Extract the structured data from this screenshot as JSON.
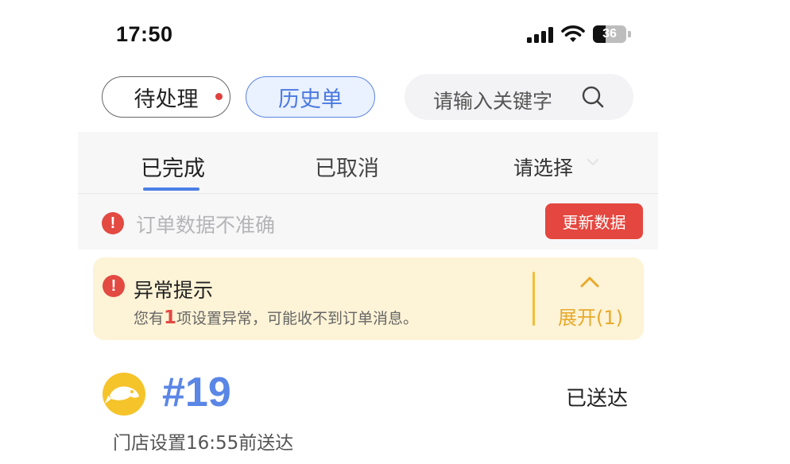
{
  "status_bar": {
    "time": "17:50",
    "battery": "36",
    "icons": [
      "cellular-signal-icon",
      "wifi-icon",
      "battery-icon"
    ]
  },
  "top_tabs": {
    "pending_label": "待处理",
    "history_label": "历史单",
    "search_placeholder": "请输入关键字"
  },
  "sub_tabs": {
    "completed": "已完成",
    "cancelled": "已取消",
    "select": "请选择"
  },
  "data_notice": {
    "text": "订单数据不准确",
    "button": "更新数据"
  },
  "alert": {
    "title": "异常提示",
    "desc_prefix": "您有",
    "count": "1",
    "desc_suffix": "项设置异常，可能收不到订单消息。",
    "expand_label": "展开(1)"
  },
  "order": {
    "number": "#19",
    "status": "已送达",
    "delivery_time": "门店设置16:55前送达"
  },
  "colors": {
    "accent_blue": "#5a86e6",
    "alert_red": "#e4473f",
    "alert_bg": "#fdf3d6",
    "expand_orange": "#e8a92a"
  }
}
